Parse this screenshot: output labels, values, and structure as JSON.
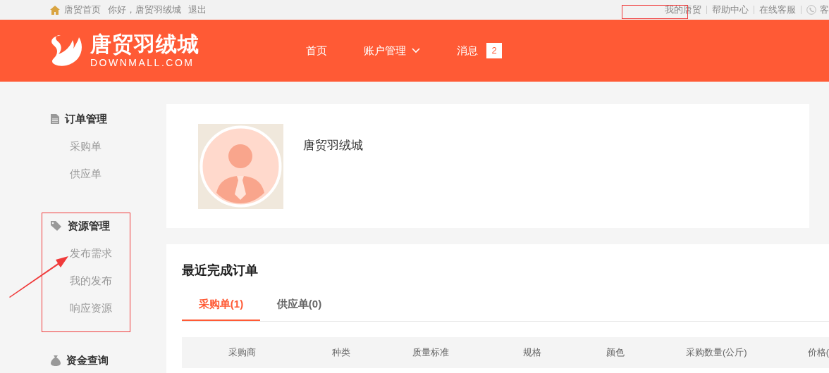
{
  "top_bar": {
    "left_links": [
      "唐贸首页",
      "你好，唐贸羽绒城",
      "退出"
    ],
    "right_links": [
      "我的唐贸",
      "帮助中心",
      "在线客服",
      "客"
    ]
  },
  "header": {
    "logo_title": "唐贸羽绒城",
    "logo_subtitle": "DOWNMALL.COM",
    "nav": [
      {
        "label": "首页",
        "dropdown": false
      },
      {
        "label": "账户管理",
        "dropdown": true
      },
      {
        "label": "消息",
        "dropdown": false,
        "badge": "2"
      }
    ]
  },
  "sidebar": [
    {
      "title": "订单管理",
      "items": [
        "采购单",
        "供应单"
      ]
    },
    {
      "title": "资源管理",
      "items": [
        "发布需求",
        "我的发布",
        "响应资源"
      ]
    },
    {
      "title": "资金查询"
    }
  ],
  "profile": {
    "name": "唐贸羽绒城"
  },
  "recent_orders": {
    "title": "最近完成订单",
    "tabs": [
      {
        "label": "采购单(1)",
        "selected": true
      },
      {
        "label": "供应单(0)",
        "selected": false
      }
    ],
    "columns": [
      "采购商",
      "种类",
      "质量标准",
      "规格",
      "颜色",
      "采购数量(公斤)",
      "价格("
    ]
  }
}
